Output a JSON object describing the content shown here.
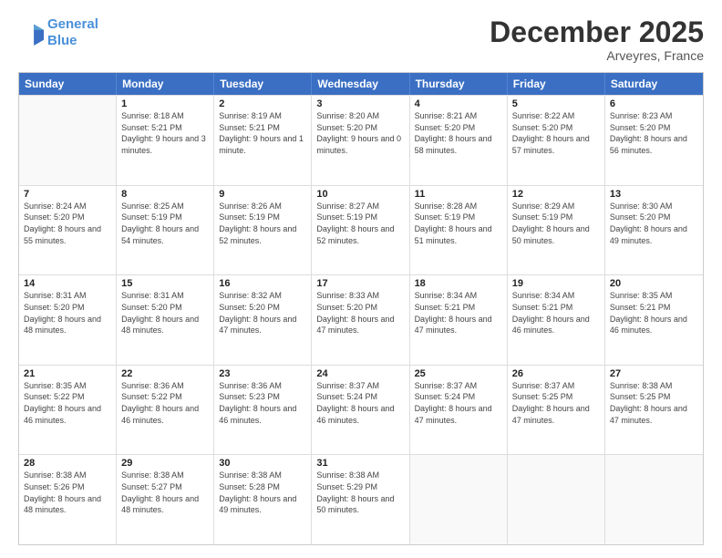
{
  "logo": {
    "line1": "General",
    "line2": "Blue"
  },
  "title": "December 2025",
  "location": "Arveyres, France",
  "header_days": [
    "Sunday",
    "Monday",
    "Tuesday",
    "Wednesday",
    "Thursday",
    "Friday",
    "Saturday"
  ],
  "weeks": [
    [
      {
        "day": "",
        "sunrise": "",
        "sunset": "",
        "daylight": ""
      },
      {
        "day": "1",
        "sunrise": "Sunrise: 8:18 AM",
        "sunset": "Sunset: 5:21 PM",
        "daylight": "Daylight: 9 hours and 3 minutes."
      },
      {
        "day": "2",
        "sunrise": "Sunrise: 8:19 AM",
        "sunset": "Sunset: 5:21 PM",
        "daylight": "Daylight: 9 hours and 1 minute."
      },
      {
        "day": "3",
        "sunrise": "Sunrise: 8:20 AM",
        "sunset": "Sunset: 5:20 PM",
        "daylight": "Daylight: 9 hours and 0 minutes."
      },
      {
        "day": "4",
        "sunrise": "Sunrise: 8:21 AM",
        "sunset": "Sunset: 5:20 PM",
        "daylight": "Daylight: 8 hours and 58 minutes."
      },
      {
        "day": "5",
        "sunrise": "Sunrise: 8:22 AM",
        "sunset": "Sunset: 5:20 PM",
        "daylight": "Daylight: 8 hours and 57 minutes."
      },
      {
        "day": "6",
        "sunrise": "Sunrise: 8:23 AM",
        "sunset": "Sunset: 5:20 PM",
        "daylight": "Daylight: 8 hours and 56 minutes."
      }
    ],
    [
      {
        "day": "7",
        "sunrise": "Sunrise: 8:24 AM",
        "sunset": "Sunset: 5:20 PM",
        "daylight": "Daylight: 8 hours and 55 minutes."
      },
      {
        "day": "8",
        "sunrise": "Sunrise: 8:25 AM",
        "sunset": "Sunset: 5:19 PM",
        "daylight": "Daylight: 8 hours and 54 minutes."
      },
      {
        "day": "9",
        "sunrise": "Sunrise: 8:26 AM",
        "sunset": "Sunset: 5:19 PM",
        "daylight": "Daylight: 8 hours and 52 minutes."
      },
      {
        "day": "10",
        "sunrise": "Sunrise: 8:27 AM",
        "sunset": "Sunset: 5:19 PM",
        "daylight": "Daylight: 8 hours and 52 minutes."
      },
      {
        "day": "11",
        "sunrise": "Sunrise: 8:28 AM",
        "sunset": "Sunset: 5:19 PM",
        "daylight": "Daylight: 8 hours and 51 minutes."
      },
      {
        "day": "12",
        "sunrise": "Sunrise: 8:29 AM",
        "sunset": "Sunset: 5:19 PM",
        "daylight": "Daylight: 8 hours and 50 minutes."
      },
      {
        "day": "13",
        "sunrise": "Sunrise: 8:30 AM",
        "sunset": "Sunset: 5:20 PM",
        "daylight": "Daylight: 8 hours and 49 minutes."
      }
    ],
    [
      {
        "day": "14",
        "sunrise": "Sunrise: 8:31 AM",
        "sunset": "Sunset: 5:20 PM",
        "daylight": "Daylight: 8 hours and 48 minutes."
      },
      {
        "day": "15",
        "sunrise": "Sunrise: 8:31 AM",
        "sunset": "Sunset: 5:20 PM",
        "daylight": "Daylight: 8 hours and 48 minutes."
      },
      {
        "day": "16",
        "sunrise": "Sunrise: 8:32 AM",
        "sunset": "Sunset: 5:20 PM",
        "daylight": "Daylight: 8 hours and 47 minutes."
      },
      {
        "day": "17",
        "sunrise": "Sunrise: 8:33 AM",
        "sunset": "Sunset: 5:20 PM",
        "daylight": "Daylight: 8 hours and 47 minutes."
      },
      {
        "day": "18",
        "sunrise": "Sunrise: 8:34 AM",
        "sunset": "Sunset: 5:21 PM",
        "daylight": "Daylight: 8 hours and 47 minutes."
      },
      {
        "day": "19",
        "sunrise": "Sunrise: 8:34 AM",
        "sunset": "Sunset: 5:21 PM",
        "daylight": "Daylight: 8 hours and 46 minutes."
      },
      {
        "day": "20",
        "sunrise": "Sunrise: 8:35 AM",
        "sunset": "Sunset: 5:21 PM",
        "daylight": "Daylight: 8 hours and 46 minutes."
      }
    ],
    [
      {
        "day": "21",
        "sunrise": "Sunrise: 8:35 AM",
        "sunset": "Sunset: 5:22 PM",
        "daylight": "Daylight: 8 hours and 46 minutes."
      },
      {
        "day": "22",
        "sunrise": "Sunrise: 8:36 AM",
        "sunset": "Sunset: 5:22 PM",
        "daylight": "Daylight: 8 hours and 46 minutes."
      },
      {
        "day": "23",
        "sunrise": "Sunrise: 8:36 AM",
        "sunset": "Sunset: 5:23 PM",
        "daylight": "Daylight: 8 hours and 46 minutes."
      },
      {
        "day": "24",
        "sunrise": "Sunrise: 8:37 AM",
        "sunset": "Sunset: 5:24 PM",
        "daylight": "Daylight: 8 hours and 46 minutes."
      },
      {
        "day": "25",
        "sunrise": "Sunrise: 8:37 AM",
        "sunset": "Sunset: 5:24 PM",
        "daylight": "Daylight: 8 hours and 47 minutes."
      },
      {
        "day": "26",
        "sunrise": "Sunrise: 8:37 AM",
        "sunset": "Sunset: 5:25 PM",
        "daylight": "Daylight: 8 hours and 47 minutes."
      },
      {
        "day": "27",
        "sunrise": "Sunrise: 8:38 AM",
        "sunset": "Sunset: 5:25 PM",
        "daylight": "Daylight: 8 hours and 47 minutes."
      }
    ],
    [
      {
        "day": "28",
        "sunrise": "Sunrise: 8:38 AM",
        "sunset": "Sunset: 5:26 PM",
        "daylight": "Daylight: 8 hours and 48 minutes."
      },
      {
        "day": "29",
        "sunrise": "Sunrise: 8:38 AM",
        "sunset": "Sunset: 5:27 PM",
        "daylight": "Daylight: 8 hours and 48 minutes."
      },
      {
        "day": "30",
        "sunrise": "Sunrise: 8:38 AM",
        "sunset": "Sunset: 5:28 PM",
        "daylight": "Daylight: 8 hours and 49 minutes."
      },
      {
        "day": "31",
        "sunrise": "Sunrise: 8:38 AM",
        "sunset": "Sunset: 5:29 PM",
        "daylight": "Daylight: 8 hours and 50 minutes."
      },
      {
        "day": "",
        "sunrise": "",
        "sunset": "",
        "daylight": ""
      },
      {
        "day": "",
        "sunrise": "",
        "sunset": "",
        "daylight": ""
      },
      {
        "day": "",
        "sunrise": "",
        "sunset": "",
        "daylight": ""
      }
    ]
  ]
}
